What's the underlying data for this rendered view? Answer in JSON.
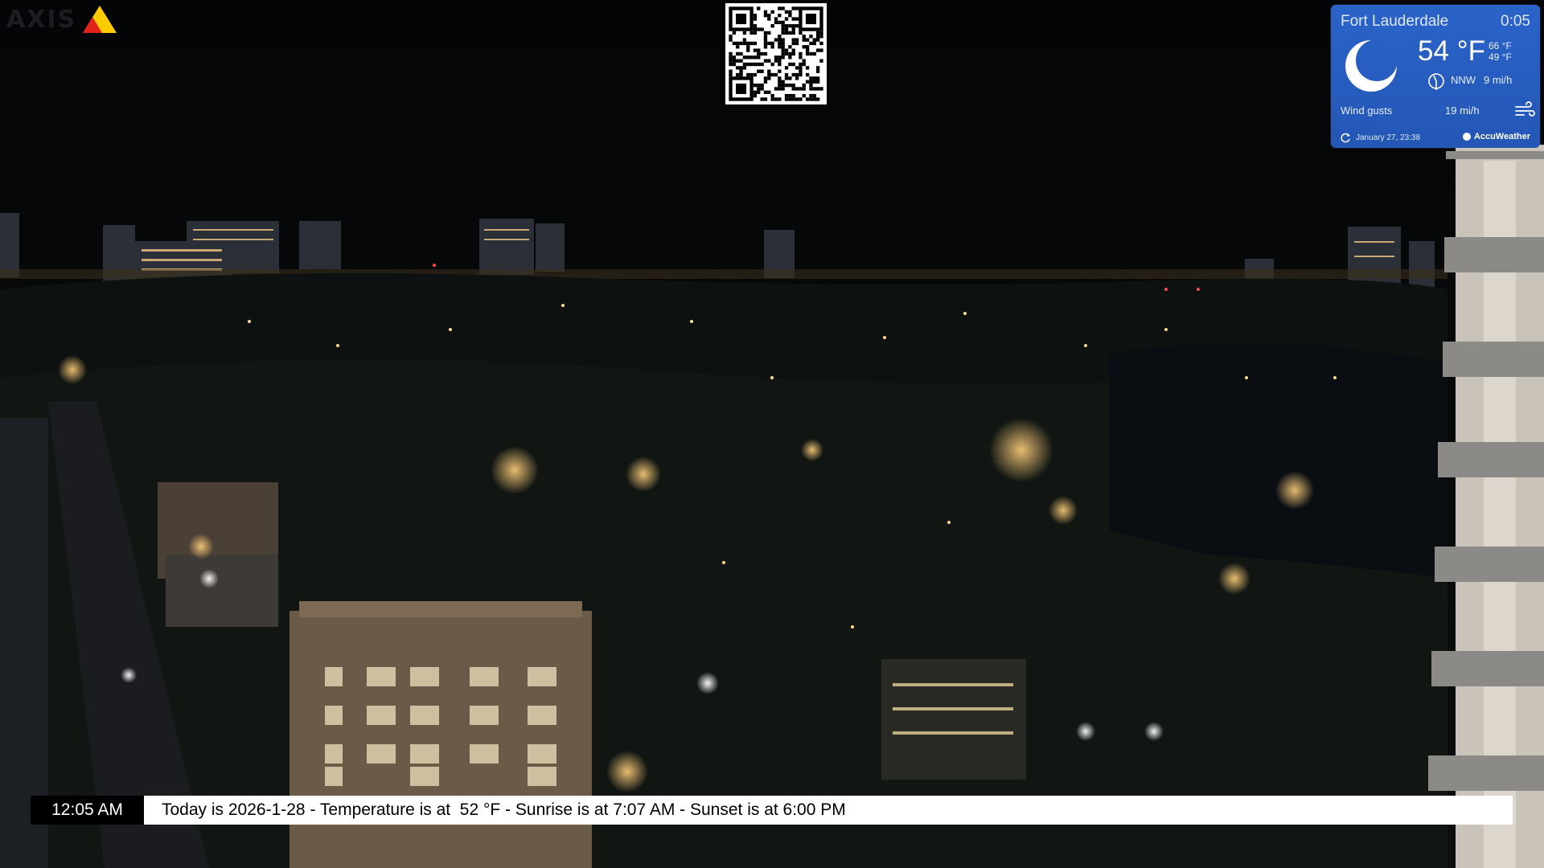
{
  "logo": {
    "text": "AXIS",
    "colors": [
      "#e2231a",
      "#ffcc00"
    ]
  },
  "qr": {
    "icon": "qr-code"
  },
  "weather": {
    "city": "Fort Lauderdale",
    "time": "0:05",
    "temperature": "54 °F",
    "high": "66 °F",
    "low": "49 °F",
    "wind_direction": "NNW",
    "wind_speed": "9 mi/h",
    "gusts_label": "Wind gusts",
    "gusts_value": "19 mi/h",
    "updated": "January 27, 23:38",
    "provider": "AccuWeather",
    "condition_icon": "crescent-moon-icon",
    "background": "#2a63c9"
  },
  "ticker": {
    "time": "12:05 AM",
    "message": "Today is 2026-1-28 - Temperature is at  52 °F - Sunrise is at 7:07 AM - Sunset is at 6:00 PM"
  }
}
